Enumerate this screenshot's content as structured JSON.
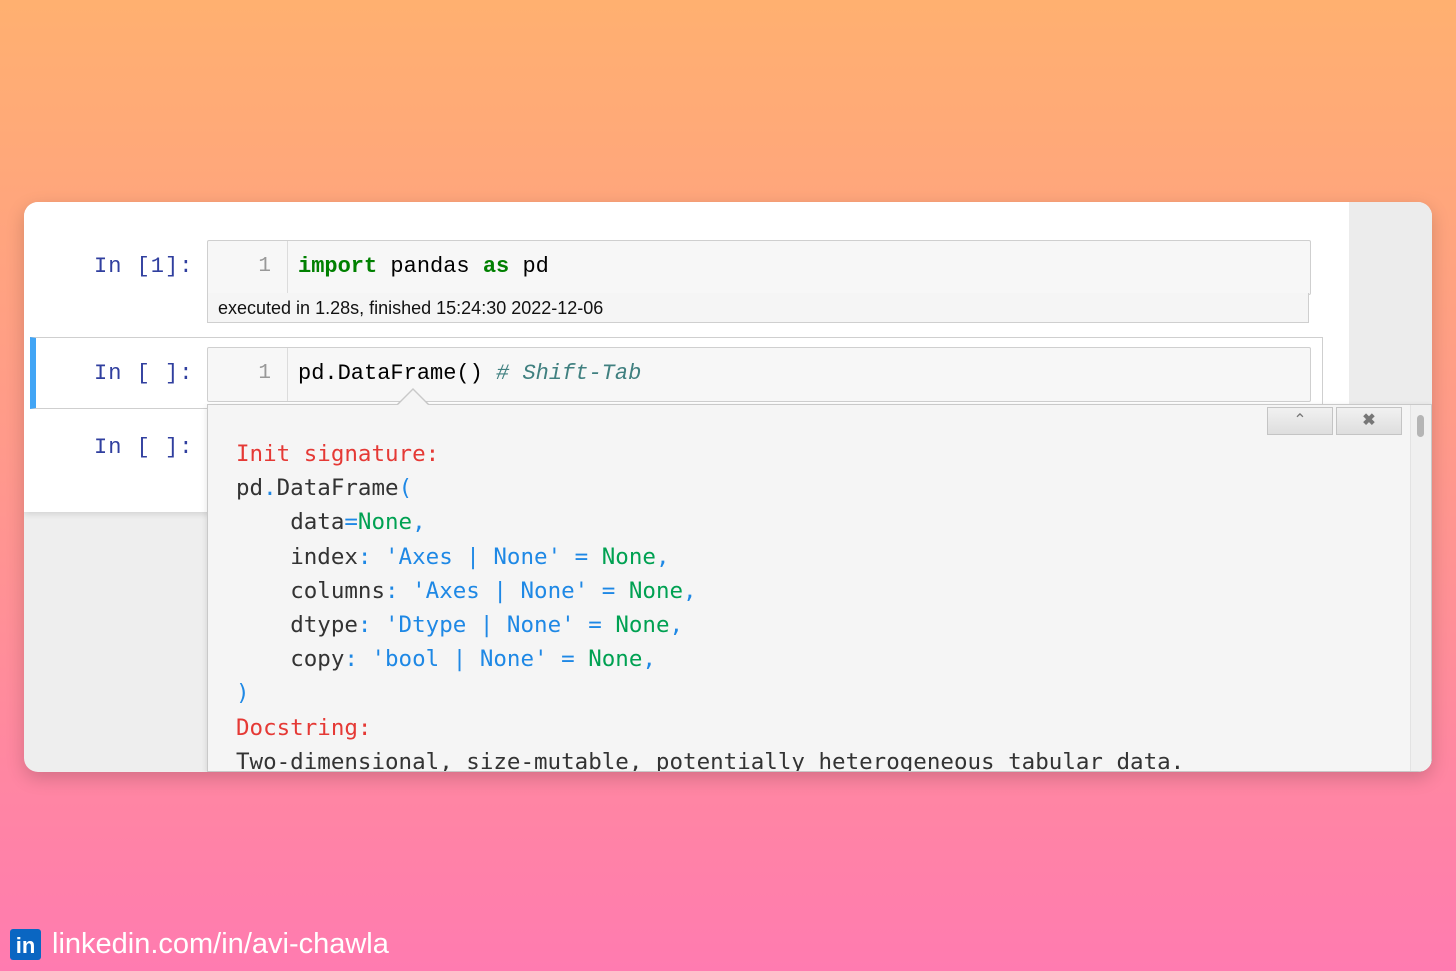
{
  "cells": [
    {
      "prompt": "In [1]:",
      "line_number": "1",
      "code": {
        "keyword_import": "import",
        "module": " pandas ",
        "keyword_as": "as",
        "alias": " pd"
      },
      "exec_info": "executed in 1.28s, finished 15:24:30 2022-12-06"
    },
    {
      "prompt": "In [ ]:",
      "line_number": "1",
      "code": {
        "text": "pd.DataFrame() ",
        "comment": "# Shift-Tab"
      }
    },
    {
      "prompt": "In [ ]:"
    }
  ],
  "tooltip": {
    "expand_icon": "chevron-up-icon",
    "close_icon": "close-icon",
    "init_signature_label": "Init signature:",
    "sig_call_obj": "pd",
    "sig_dot": ".",
    "sig_call_name": "DataFrame",
    "sig_open": "(",
    "params": [
      {
        "name": "data",
        "sep": "=",
        "annotation": "",
        "default": "None"
      },
      {
        "name": "index",
        "sep": ": ",
        "annotation": "'Axes | None'",
        "default": "None"
      },
      {
        "name": "columns",
        "sep": ": ",
        "annotation": "'Axes | None'",
        "default": "None"
      },
      {
        "name": "dtype",
        "sep": ": ",
        "annotation": "'Dtype | None'",
        "default": "None"
      },
      {
        "name": "copy",
        "sep": ": ",
        "annotation": "'bool | None'",
        "default": "None"
      }
    ],
    "sig_close": ")",
    "docstring_label": "Docstring:",
    "docstring_first_line": "Two-dimensional, size-mutable, potentially heterogeneous tabular data."
  },
  "footer": {
    "logo_text": "in",
    "url": "linkedin.com/in/avi-chawla"
  },
  "colors": {
    "prompt": "#303f9f",
    "keyword": "#008000",
    "comment": "#408080",
    "selected_border": "#42a5f5",
    "tooltip_heading": "#e53935",
    "tooltip_blue": "#1e88e5",
    "tooltip_green": "#00a152",
    "linkedin": "#0a66c2"
  }
}
